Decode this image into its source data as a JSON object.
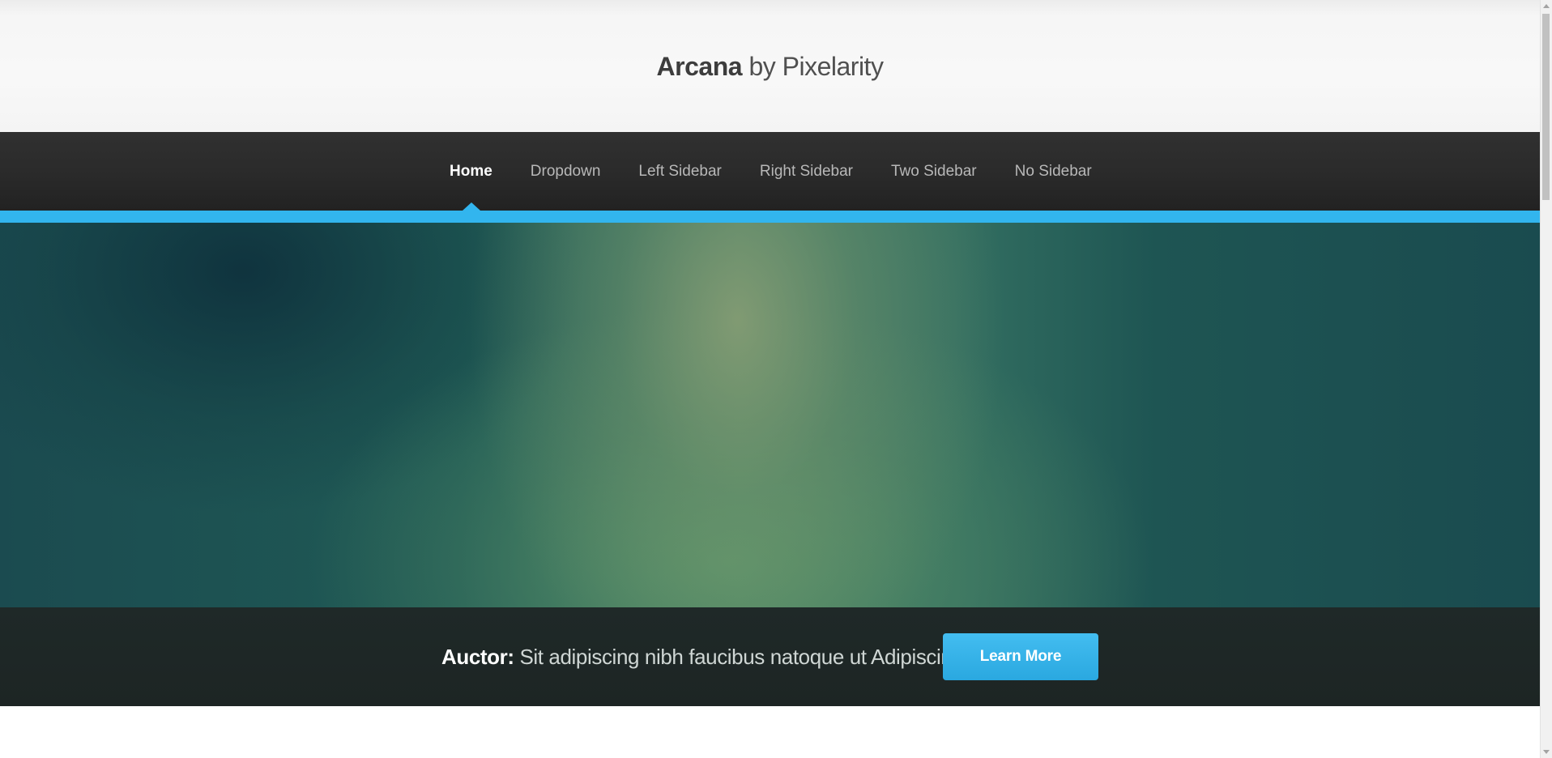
{
  "header": {
    "brand": "Arcana",
    "tagline": " by Pixelarity"
  },
  "nav": {
    "items": [
      {
        "label": "Home",
        "active": true
      },
      {
        "label": "Dropdown"
      },
      {
        "label": "Left Sidebar"
      },
      {
        "label": "Right Sidebar"
      },
      {
        "label": "Two Sidebar"
      },
      {
        "label": "No Sidebar"
      }
    ]
  },
  "cta": {
    "label": "Auctor:",
    "text": " Sit adipiscing nibh faucibus natoque ut Adipiscing",
    "button_label": "Learn More"
  },
  "colors": {
    "accent": "#32b5ee",
    "nav_bg": "#2b2b2b",
    "cta_bg": "#1f2928"
  }
}
